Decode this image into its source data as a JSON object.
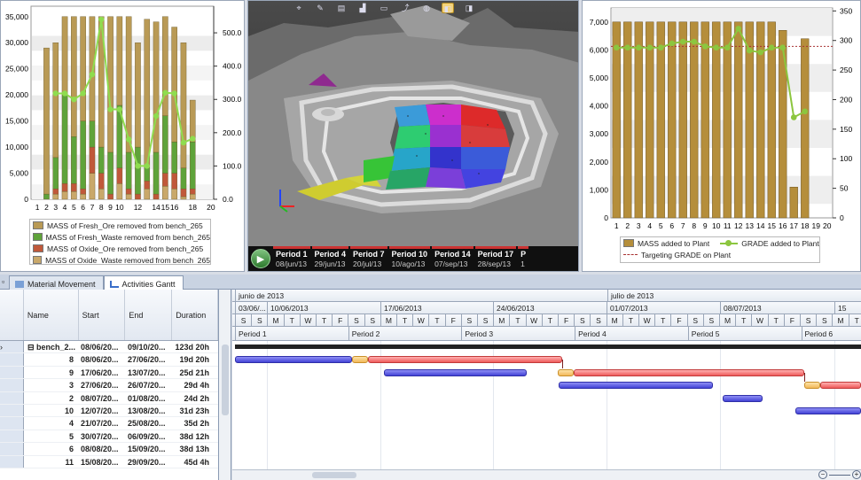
{
  "left_chart": {
    "y_left_ticks": [
      "0",
      "5,000",
      "10,000",
      "15,000",
      "20,000",
      "25,000",
      "30,000",
      "35,000"
    ],
    "y_right_ticks": [
      "0.0",
      "100.0",
      "200.0",
      "300.0",
      "400.0",
      "500.0"
    ],
    "x_ticks": [
      "1",
      "2",
      "3",
      "4",
      "5",
      "6",
      "7",
      "8",
      "9",
      "10",
      "12",
      "14",
      "15",
      "16",
      "18",
      "20"
    ],
    "legend": [
      "MASS of Fresh_Ore removed from bench_265",
      "MASS of Fresh_Waste removed from bench_265",
      "MASS of Oxide_Ore removed from bench_265",
      "MASS of Oxide_Waste removed from bench_265"
    ],
    "colors": {
      "fresh_ore": "#b99a55",
      "fresh_waste": "#5fa33a",
      "oxide_ore": "#c0583a",
      "oxide_waste": "#c9a86a",
      "line": "#8fdc4f"
    }
  },
  "chart_data": [
    {
      "type": "bar",
      "title": "",
      "xlabel": "",
      "ylabel": "",
      "ylim": [
        0,
        37000
      ],
      "y2lim": [
        0,
        580
      ],
      "categories": [
        "2",
        "3",
        "4",
        "5",
        "6",
        "7",
        "8",
        "9",
        "10",
        "11",
        "12",
        "13",
        "14",
        "15",
        "16",
        "17",
        "18"
      ],
      "series": [
        {
          "name": "MASS of Fresh_Ore removed from bench_265",
          "values": [
            28000,
            22000,
            15000,
            23000,
            20000,
            20000,
            25000,
            26000,
            17000,
            26000,
            20000,
            28000,
            25000,
            19000,
            22000,
            24000,
            8000
          ]
        },
        {
          "name": "MASS of Fresh_Waste removed from bench_265",
          "values": [
            1000,
            6000,
            17000,
            9000,
            13000,
            5000,
            5000,
            8000,
            12000,
            7000,
            9000,
            3000,
            8000,
            11000,
            6000,
            4000,
            9000
          ]
        },
        {
          "name": "MASS of Oxide_Ore removed from bench_265",
          "values": [
            0,
            1000,
            1500,
            1500,
            1000,
            5000,
            3000,
            1000,
            3000,
            1000,
            1000,
            1500,
            1000,
            2500,
            3000,
            1500,
            1000
          ]
        },
        {
          "name": "MASS of Oxide_Waste removed from bench_265",
          "values": [
            0,
            1000,
            1500,
            1500,
            1000,
            5000,
            2000,
            0,
            3000,
            1000,
            0,
            2000,
            0,
            2500,
            2000,
            500,
            1000
          ]
        },
        {
          "name": "grade line",
          "values": [
            null,
            318,
            318,
            300,
            318,
            375,
            540,
            270,
            270,
            180,
            100,
            100,
            250,
            320,
            318,
            170,
            182
          ]
        }
      ]
    },
    {
      "type": "bar",
      "title": "",
      "xlabel": "",
      "ylabel": "",
      "ylim": [
        0,
        7500
      ],
      "y2lim": [
        0,
        355
      ],
      "categories": [
        "1",
        "2",
        "3",
        "4",
        "5",
        "6",
        "7",
        "8",
        "9",
        "10",
        "11",
        "12",
        "13",
        "14",
        "15",
        "16",
        "17",
        "18",
        "19",
        "20"
      ],
      "series": [
        {
          "name": "MASS added to Plant",
          "values": [
            7000,
            7000,
            7000,
            7000,
            7000,
            7000,
            7000,
            7000,
            7000,
            7000,
            7000,
            7000,
            7000,
            7000,
            7000,
            6700,
            1100,
            6400,
            null,
            null
          ]
        },
        {
          "name": "GRADE added to Plant",
          "values": [
            288,
            288,
            288,
            288,
            288,
            295,
            298,
            298,
            290,
            288,
            288,
            320,
            283,
            280,
            288,
            288,
            170,
            180,
            null,
            null
          ]
        },
        {
          "name": "Targeting GRADE on Plant",
          "values": [
            290,
            290,
            290,
            290,
            290,
            290,
            290,
            290,
            290,
            290,
            290,
            290,
            290,
            290,
            290,
            290,
            290,
            290,
            290,
            290
          ]
        }
      ]
    }
  ],
  "right_chart": {
    "y_left_ticks": [
      "0",
      "1,000",
      "2,000",
      "3,000",
      "4,000",
      "5,000",
      "6,000",
      "7,000"
    ],
    "y_right_ticks": [
      "0",
      "50",
      "100",
      "150",
      "200",
      "250",
      "300",
      "350"
    ],
    "x_ticks": [
      "1",
      "2",
      "3",
      "4",
      "5",
      "6",
      "7",
      "8",
      "9",
      "10",
      "11",
      "12",
      "13",
      "14",
      "15",
      "16",
      "17",
      "18",
      "19",
      "20"
    ],
    "legend": {
      "mass": "MASS added to Plant",
      "grade": "GRADE added to Plant",
      "target": "Targeting GRADE on Plant"
    },
    "colors": {
      "mass": "#b58e3b",
      "grade": "#8cc63f",
      "target": "#a83232"
    }
  },
  "view3d": {
    "toolbar_icons": [
      "axes-icon",
      "select-icon",
      "blocks-icon",
      "surface-icon",
      "section-icon",
      "path-icon",
      "solid-icon",
      "shade-icon",
      "render-icon"
    ],
    "periods": [
      {
        "name": "Period 1",
        "date": "08/jun/13"
      },
      {
        "name": "Period 4",
        "date": "29/jun/13"
      },
      {
        "name": "Period 7",
        "date": "20/jul/13"
      },
      {
        "name": "Period 10",
        "date": "10/ago/13"
      },
      {
        "name": "Period 14",
        "date": "07/sep/13"
      },
      {
        "name": "Period 17",
        "date": "28/sep/13"
      },
      {
        "name": "P",
        "date": "1"
      }
    ]
  },
  "tabs": [
    {
      "label": "Material Movement"
    },
    {
      "label": "Activities Gantt"
    }
  ],
  "grid": {
    "columns": [
      "Name",
      "Start",
      "End",
      "Duration"
    ],
    "rows": [
      {
        "name": "bench_2...",
        "start": "08/06/20...",
        "end": "09/10/20...",
        "dur": "123d 20h"
      },
      {
        "name": "8",
        "start": "08/06/20...",
        "end": "27/06/20...",
        "dur": "19d 20h"
      },
      {
        "name": "9",
        "start": "17/06/20...",
        "end": "13/07/20...",
        "dur": "25d 21h"
      },
      {
        "name": "3",
        "start": "27/06/20...",
        "end": "26/07/20...",
        "dur": "29d 4h"
      },
      {
        "name": "2",
        "start": "08/07/20...",
        "end": "01/08/20...",
        "dur": "24d 2h"
      },
      {
        "name": "10",
        "start": "12/07/20...",
        "end": "13/08/20...",
        "dur": "31d 23h"
      },
      {
        "name": "4",
        "start": "21/07/20...",
        "end": "25/08/20...",
        "dur": "35d 2h"
      },
      {
        "name": "5",
        "start": "30/07/20...",
        "end": "06/09/20...",
        "dur": "38d 12h"
      },
      {
        "name": "6",
        "start": "08/08/20...",
        "end": "15/09/20...",
        "dur": "38d 13h"
      },
      {
        "name": "11",
        "start": "15/08/20...",
        "end": "29/09/20...",
        "dur": "45d 4h"
      }
    ]
  },
  "gantt": {
    "months": [
      "junio de 2013",
      "julio de 2013"
    ],
    "weeks": [
      "03/06/...",
      "10/06/2013",
      "17/06/2013",
      "24/06/2013",
      "01/07/2013",
      "08/07/2013",
      "15"
    ],
    "days": [
      "S",
      "S",
      "M",
      "T",
      "W",
      "T",
      "F",
      "S",
      "S",
      "M",
      "T",
      "W",
      "T",
      "F",
      "S",
      "S",
      "M",
      "T",
      "W",
      "T",
      "F",
      "S",
      "S",
      "M",
      "T",
      "W",
      "T",
      "F",
      "S",
      "S",
      "M",
      "T",
      "W",
      "T",
      "F",
      "S",
      "S",
      "M",
      "T",
      "W",
      "T",
      "F",
      "S",
      "S",
      "M",
      "T",
      "W",
      "T",
      "F",
      "S",
      "S"
    ],
    "periods": [
      "Period 1",
      "Period 2",
      "Period 3",
      "Period 4",
      "Period 5",
      "Period 6"
    ]
  }
}
